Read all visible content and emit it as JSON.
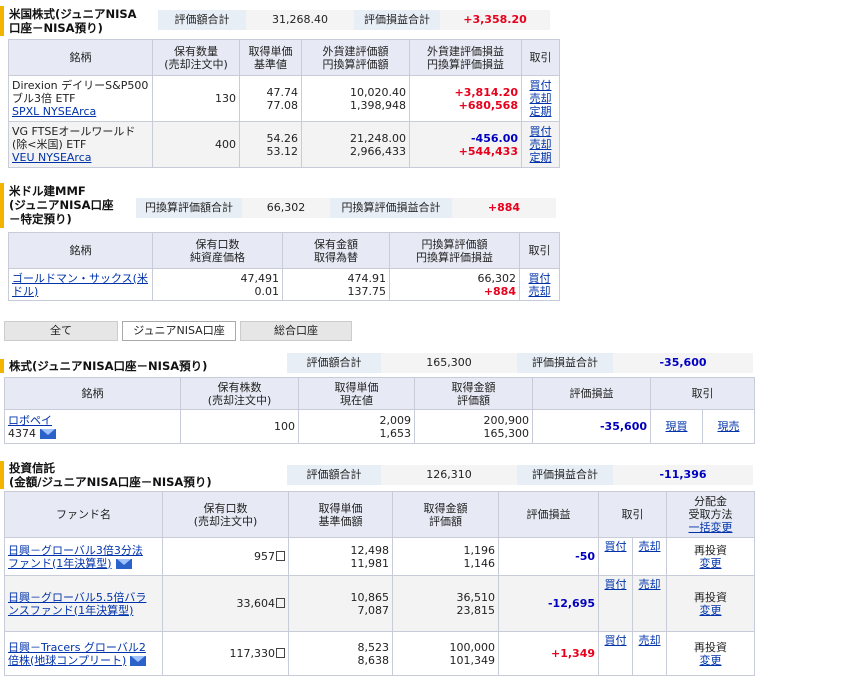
{
  "us_stock": {
    "title_line1": "米国株式(ジュニアNISA",
    "title_line2": "口座－NISA預り)",
    "sum_label1": "評価額合計",
    "sum_value1": "31,268.40",
    "sum_label2": "評価損益合計",
    "sum_value2": "+3,358.20",
    "headers": [
      "銘柄",
      "保有数量\n(売却注文中)",
      "取得単価\n基準値",
      "外貨建評価額\n円換算評価額",
      "外貨建評価損益\n円換算評価損益",
      "取引"
    ],
    "rows": [
      {
        "name1": "Direxion デイリーS&P500",
        "name2": "ブル3倍 ETF",
        "link": "SPXL NYSEArca",
        "qty": "130",
        "price1": "47.74",
        "price2": "77.08",
        "val1": "10,020.40",
        "val2": "1,398,948",
        "pl1": "+3,814.20",
        "pl2": "+680,568",
        "a1": "買付",
        "a2": "売却",
        "a3": "定期"
      },
      {
        "name1": "VG FTSEオールワールド",
        "name2": "(除<米国) ETF",
        "link": "VEU NYSEArca",
        "qty": "400",
        "price1": "54.26",
        "price2": "53.12",
        "val1": "21,248.00",
        "val2": "2,966,433",
        "pl1": "-456.00",
        "pl2": "+544,433",
        "a1": "買付",
        "a2": "売却",
        "a3": "定期"
      }
    ]
  },
  "mmf": {
    "title_line1": "米ドル建MMF",
    "title_line2": "(ジュニアNISA口座",
    "title_line3": "－特定預り)",
    "sum_label1": "円換算評価額合計",
    "sum_value1": "66,302",
    "sum_label2": "円換算評価損益合計",
    "sum_value2": "+884",
    "headers": [
      "銘柄",
      "保有口数\n純資産価格",
      "保有金額\n取得為替",
      "円換算評価額\n円換算評価損益",
      "取引"
    ],
    "rows": [
      {
        "name": "ゴールドマン・サックス(米ドル)",
        "v1": "47,491",
        "v2": "0.01",
        "m1": "474.91",
        "m2": "137.75",
        "e1": "66,302",
        "e2": "+884",
        "a1": "買付",
        "a2": "売却"
      }
    ]
  },
  "tabs": [
    "全て",
    "ジュニアNISA口座",
    "総合口座"
  ],
  "jp_stock": {
    "title": "株式(ジュニアNISA口座－NISA預り)",
    "sum_label1": "評価額合計",
    "sum_value1": "165,300",
    "sum_label2": "評価損益合計",
    "sum_value2": "-35,600",
    "headers": [
      "銘柄",
      "保有株数\n(売却注文中)",
      "取得単価\n現在値",
      "取得金額\n評価額",
      "評価損益",
      "取引"
    ],
    "rows": [
      {
        "name": "ロボペイ",
        "code": "4374",
        "qty": "100",
        "p1": "2,009",
        "p2": "1,653",
        "m1": "200,900",
        "m2": "165,300",
        "pl": "-35,600",
        "a1": "現買",
        "a2": "現売"
      }
    ]
  },
  "fund": {
    "title_line1": "投資信託",
    "title_line2": "(金額/ジュニアNISA口座－NISA預り)",
    "sum_label1": "評価額合計",
    "sum_value1": "126,310",
    "sum_label2": "評価損益合計",
    "sum_value2": "-11,396",
    "headers": [
      "ファンド名",
      "保有口数\n(売却注文中)",
      "取得単価\n基準価額",
      "取得金額\n評価額",
      "評価損益",
      "取引",
      "分配金\n受取方法"
    ],
    "bulk_change": "一括変更",
    "rows": [
      {
        "name1": "日興－グローバル3倍3分法",
        "name2": "ファンド(1年決算型)",
        "qty": "957",
        "p1": "12,498",
        "p2": "11,981",
        "m1": "1,196",
        "m2": "1,146",
        "pl": "-50",
        "a1": "買付",
        "a2": "売却",
        "d1": "再投資",
        "d2": "変更"
      },
      {
        "name1": "日興－グローバル5.5倍バラ",
        "name2": "ンスファンド(1年決算型)",
        "qty": "33,604",
        "p1": "10,865",
        "p2": "7,087",
        "m1": "36,510",
        "m2": "23,815",
        "pl": "-12,695",
        "a1": "買付",
        "a2": "売却",
        "d1": "再投資",
        "d2": "変更"
      },
      {
        "name1": "日興－Tracers グローバル2",
        "name2": "倍株(地球コンプリート)",
        "qty": "117,330",
        "p1": "8,523",
        "p2": "8,638",
        "m1": "100,000",
        "m2": "101,349",
        "pl": "+1,349",
        "a1": "買付",
        "a2": "売却",
        "d1": "再投資",
        "d2": "変更"
      }
    ]
  },
  "icons": {
    "mail": "mail-icon",
    "unit_box": "unit-box-icon"
  },
  "colors": {
    "plus": "#e8001c",
    "minus": "#0000c0",
    "header_bg": "#e7eaf4",
    "section_bar": "#f2b400"
  }
}
